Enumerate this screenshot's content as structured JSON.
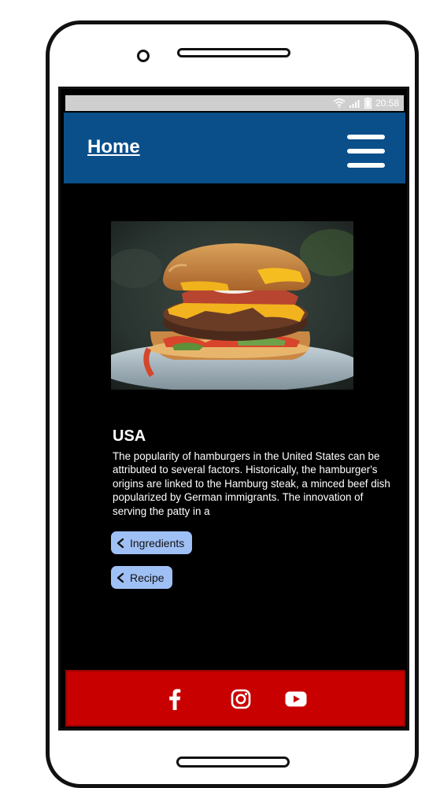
{
  "status_bar": {
    "time": "20:58",
    "icons": [
      "wifi-icon",
      "signal-icon",
      "battery-icon"
    ]
  },
  "header": {
    "home_label": "Home",
    "menu_icon": "hamburger-menu-icon",
    "background": "#0a4f8a"
  },
  "main": {
    "image": {
      "icon": "hamburger-food-photo"
    },
    "country": "USA",
    "description": "The popularity of hamburgers in the United States can be attributed to several factors. Historically, the hamburger's origins are linked to the Hamburg steak, a minced beef dish popularized by German immigrants. The innovation of serving the patty in a",
    "buttons": {
      "ingredients_label": "Ingredients",
      "recipe_label": "Recipe",
      "icon": "chevron-left-icon",
      "color": "#9fc0f5"
    }
  },
  "footer": {
    "background": "#c80000",
    "social_icons": [
      "facebook-icon",
      "instagram-icon",
      "youtube-icon"
    ]
  }
}
